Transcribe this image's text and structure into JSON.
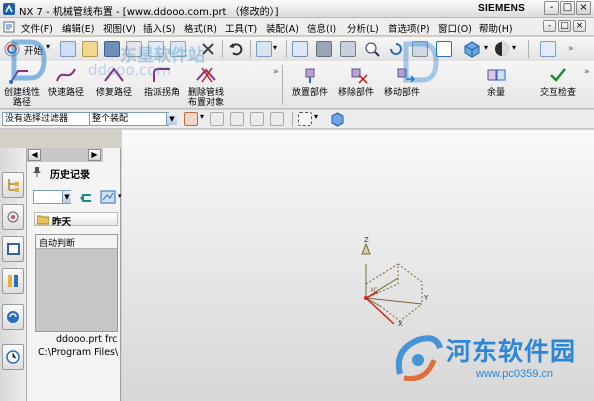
{
  "window": {
    "title": "NX 7 - 机械管线布置 - [www.ddooo.com.prt （修改的）]",
    "brand": "SIEMENS",
    "controls": [
      "-",
      "□",
      "×"
    ]
  },
  "menubar": {
    "items": [
      "文件(F)",
      "编辑(E)",
      "视图(V)",
      "插入(S)",
      "格式(R)",
      "工具(T)",
      "装配(A)",
      "信息(I)",
      "分析(L)",
      "首选项(P)",
      "窗口(O)",
      "帮助(H)"
    ],
    "mdi_controls": [
      "-",
      "□",
      "×"
    ]
  },
  "toolbar_top": {
    "start_label": "开始"
  },
  "routing_toolbar": {
    "buttons": [
      "创建线性路径",
      "快速路径",
      "修复路径",
      "指派拐角",
      "删除管线布置对象"
    ]
  },
  "assembly_toolbar": {
    "buttons": [
      "放置部件",
      "移除部件",
      "移动部件",
      "余量",
      "交互检查"
    ]
  },
  "selection_bar": {
    "filter_value": "没有选择过滤器",
    "scope_value": "整个装配"
  },
  "navigator": {
    "title": "历史记录",
    "group_header": "昨天",
    "history_item": "自动判断",
    "file_name": "ddooo.prt frc",
    "file_path": "C:\\Program Files\\"
  },
  "watermarks": {
    "top_cn": "东星软件站",
    "top_url": "ddooo.com",
    "bottom_cn": "河东软件园",
    "bottom_url": "www.pc0359.cn"
  },
  "triad": {
    "z": "Z",
    "x": "X",
    "y": "Y",
    "xc": "XC"
  },
  "colors": {
    "accent_blue": "#2a6ec2",
    "triad_brown": "#7a6a3a",
    "triad_red": "#d2271b",
    "watermark_blue": "#2d86d6"
  }
}
